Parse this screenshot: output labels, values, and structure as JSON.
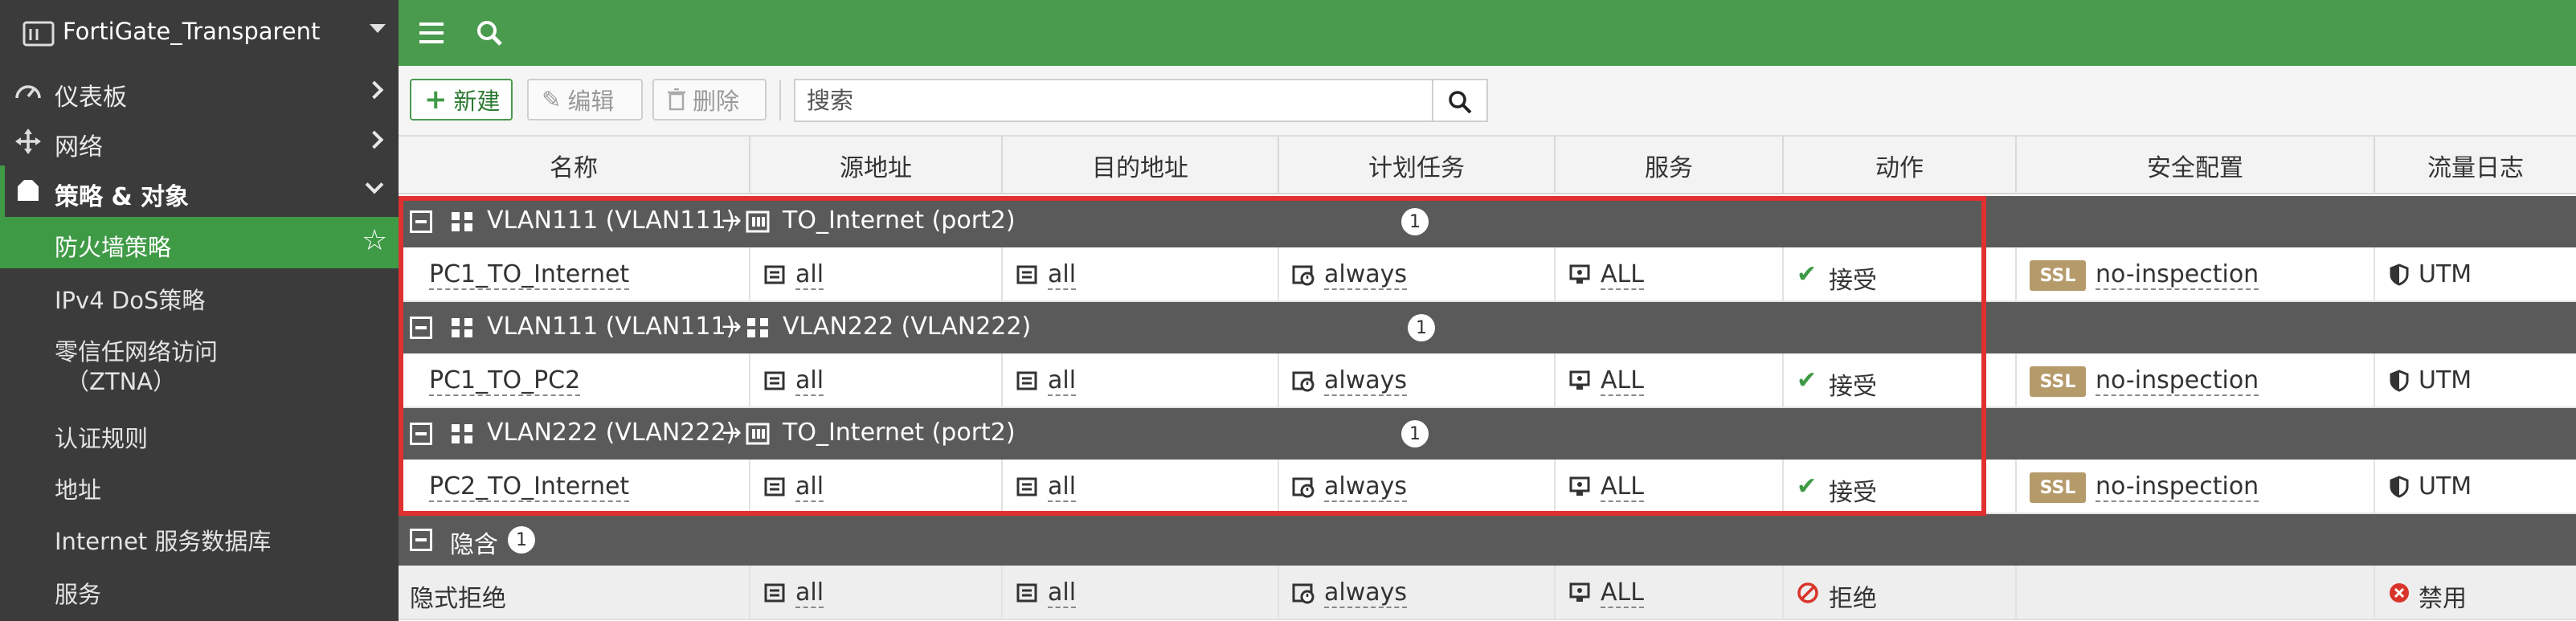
{
  "sidebar": {
    "device_name": "FortiGate_Transparent",
    "items": [
      {
        "label": "仪表板"
      },
      {
        "label": "网络"
      },
      {
        "label": "策略 & 对象"
      }
    ],
    "sub_items": [
      {
        "label": "防火墙策略"
      },
      {
        "label": "IPv4 DoS策略"
      },
      {
        "label": "零信任网络访问",
        "label2": "（ZTNA）"
      },
      {
        "label": "认证规则"
      },
      {
        "label": "地址"
      },
      {
        "label": "Internet 服务数据库"
      },
      {
        "label": "服务"
      }
    ]
  },
  "toolbar": {
    "new_label": "新建",
    "edit_label": "编辑",
    "delete_label": "删除",
    "search_placeholder": "搜索"
  },
  "table": {
    "columns": [
      "名称",
      "源地址",
      "目的地址",
      "计划任务",
      "服务",
      "动作",
      "安全配置",
      "流量日志"
    ],
    "groups": [
      {
        "src": "VLAN111 (VLAN111)",
        "arrow": "→",
        "dst": "TO_Internet (port2)",
        "count": "1",
        "row": {
          "name": "PC1_TO_Internet",
          "src": "all",
          "dst": "all",
          "schedule": "always",
          "service": "ALL",
          "action": "接受",
          "ssl": "SSL",
          "profile": "no-inspection",
          "log": "UTM"
        }
      },
      {
        "src": "VLAN111 (VLAN111)",
        "arrow": "→",
        "dst": "VLAN222 (VLAN222)",
        "count": "1",
        "row": {
          "name": "PC1_TO_PC2",
          "src": "all",
          "dst": "all",
          "schedule": "always",
          "service": "ALL",
          "action": "接受",
          "ssl": "SSL",
          "profile": "no-inspection",
          "log": "UTM"
        }
      },
      {
        "src": "VLAN222 (VLAN222)",
        "arrow": "→",
        "dst": "TO_Internet (port2)",
        "count": "1",
        "row": {
          "name": "PC2_TO_Internet",
          "src": "all",
          "dst": "all",
          "schedule": "always",
          "service": "ALL",
          "action": "接受",
          "ssl": "SSL",
          "profile": "no-inspection",
          "log": "UTM"
        }
      }
    ],
    "implicit_group": {
      "label": "隐含",
      "count": "1",
      "row": {
        "name": "隐式拒绝",
        "src": "all",
        "dst": "all",
        "schedule": "always",
        "service": "ALL",
        "action": "拒绝",
        "log": "禁用"
      }
    }
  },
  "colors": {
    "brand_green": "#4b9b4f",
    "sidebar_bg": "#3b3b3b",
    "group_bg": "#5a5a5a",
    "highlight": "#e03030",
    "accept": "#3f9a46",
    "deny": "#d9342b",
    "ssl_badge": "#b59a6a"
  }
}
